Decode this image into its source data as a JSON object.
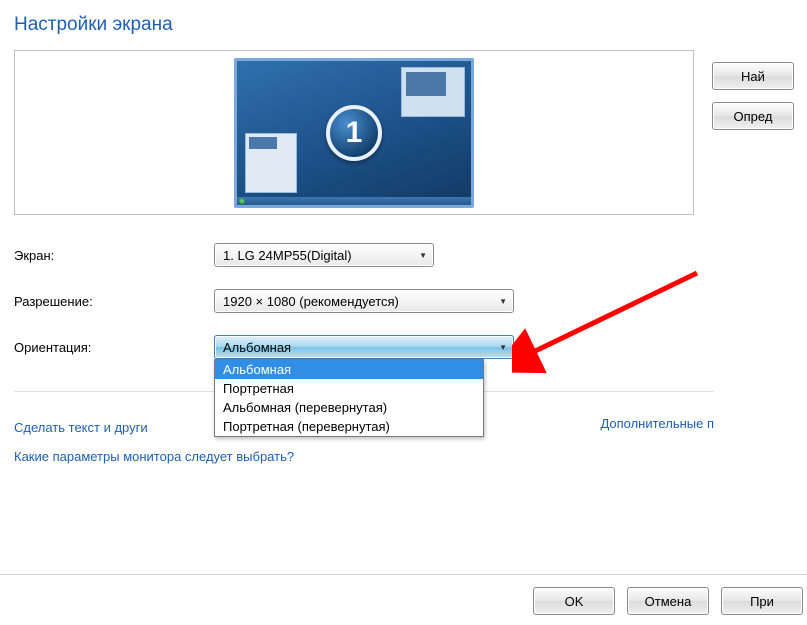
{
  "title": "Настройки экрана",
  "monitor_badge": "1",
  "buttons": {
    "find": "Най",
    "detect": "Опред",
    "ok": "OK",
    "cancel": "Отмена",
    "apply": "При"
  },
  "labels": {
    "screen": "Экран:",
    "resolution": "Разрешение:",
    "orientation": "Ориентация:"
  },
  "screen_select": "1. LG 24MP55(Digital)",
  "resolution_select": "1920 × 1080 (рекомендуется)",
  "orientation_select": "Альбомная",
  "orientation_options": [
    "Альбомная",
    "Портретная",
    "Альбомная (перевернутая)",
    "Портретная (перевернутая)"
  ],
  "links": {
    "advanced": "Дополнительные п",
    "text_size": "Сделать текст и други",
    "which_params": "Какие параметры монитора следует выбрать?"
  }
}
